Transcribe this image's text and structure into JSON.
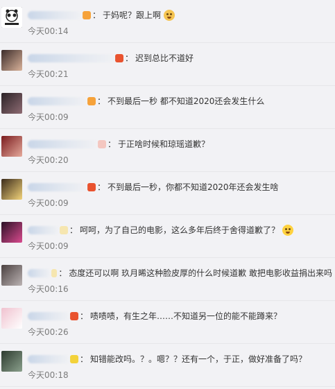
{
  "comments": [
    {
      "avatar_color": "#1d1d1d",
      "avatar_accent": "#ffffff",
      "name_width": 80,
      "badge_color": "#f6a23a",
      "text": "于妈呢？跟上啊",
      "emoji": "dog-emoji",
      "time": "今天00:14"
    },
    {
      "avatar_color": "#3b2c2a",
      "avatar_accent": "#d9b29a",
      "name_width": 125,
      "badge_color": "#e9532f",
      "text": "迟到总比不道好",
      "emoji": "",
      "time": "今天00:21"
    },
    {
      "avatar_color": "#2a2226",
      "avatar_accent": "#8e6b73",
      "name_width": 85,
      "badge_color": "#f6a23a",
      "text": "不到最后一秒 都不知道2020还会发生什么",
      "emoji": "",
      "time": "今天00:09"
    },
    {
      "avatar_color": "#7a1b1e",
      "avatar_accent": "#e5a99b",
      "name_width": 100,
      "badge_color": "#f4c7c0",
      "text": "于正啥时候和琼瑶道歉？",
      "emoji": "",
      "time": "今天00:20"
    },
    {
      "avatar_color": "#3a2a1b",
      "avatar_accent": "#f2d37a",
      "name_width": 85,
      "badge_color": "#e9532f",
      "text": "不到最后一秒，你都不知道2020年还会发生啥",
      "emoji": "",
      "time": "今天00:09"
    },
    {
      "avatar_color": "#2a1025",
      "avatar_accent": "#d94b8f",
      "name_width": 45,
      "badge_color": "#f6e6b0",
      "text": "呵呵，为了自己的电影，这么多年后终于舍得道歉了？",
      "emoji": "grin-emoji",
      "time": "今天00:09"
    },
    {
      "avatar_color": "#4a4040",
      "avatar_accent": "#bbb3b3",
      "name_width": 45,
      "badge_color": "#f6e6b0",
      "text": "态度还可以啊 玖月晞这种脸皮厚的什么时候道歉 敢把电影收益捐出来吗",
      "emoji": "",
      "time": "今天00:16"
    },
    {
      "avatar_color": "#f0c2cf",
      "avatar_accent": "#ffffff",
      "name_width": 60,
      "badge_color": "#e9532f",
      "text": "啧啧啧，有生之年……不知道另一位的能不能蹲来？",
      "emoji": "",
      "time": "今天00:26"
    },
    {
      "avatar_color": "#2d3a2f",
      "avatar_accent": "#8aa08c",
      "name_width": 60,
      "badge_color": "#f3d23a",
      "text": "知错能改吗。？。嗯？？还有一个，于正，做好准备了吗？",
      "emoji": "",
      "time": "今天00:18"
    }
  ]
}
